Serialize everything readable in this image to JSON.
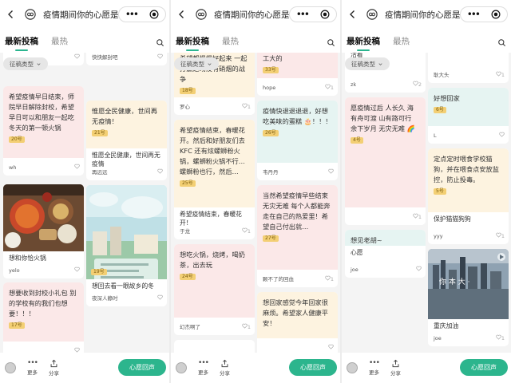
{
  "header": {
    "title": "疫情期间你的心愿是...",
    "tabs": [
      "最新投稿",
      "最热"
    ],
    "filter_label": "征稿类型"
  },
  "bottom": {
    "more": "更多",
    "share": "分享",
    "cta": "心愿回声"
  },
  "colors": {
    "accent": "#2cb58d",
    "pink": "#fbe8e8",
    "yellow": "#fdf3e0",
    "teal": "#e6f4f2",
    "badge": "#f3cf74"
  },
  "screens": [
    {
      "left": [
        {
          "kind": "tail",
          "user": "...",
          "likes": ""
        },
        {
          "kind": "text",
          "tint": "pink",
          "text": "希望疫情早日结束，师院早日解除封校，希望早日可以和朋友一起吃冬天的第一顿火锅",
          "badge": "20号",
          "user": "wh",
          "likes": ""
        },
        {
          "kind": "image",
          "scene": "food",
          "title": "想和你恰火锅",
          "user": "yelo",
          "likes": ""
        },
        {
          "kind": "text",
          "tint": "pink",
          "text": "想要收到封校小礼包 别的学校有的我们也想要！！！",
          "badge": "17号",
          "user": "",
          "likes": ""
        }
      ],
      "right": [
        {
          "kind": "tail",
          "user": "快快解封吧",
          "likes": ""
        },
        {
          "kind": "text",
          "tint": "yellow",
          "text": "惟愿全民健康，世间再无疫情！",
          "badge": "21号",
          "title": "惟愿全民健康，世间再无疫情",
          "user": "再远远",
          "likes": ""
        },
        {
          "kind": "image",
          "scene": "poster",
          "badge": "19号",
          "title": "想回去看一眼故乡的冬",
          "user": "夜深人静时",
          "likes": ""
        }
      ]
    },
    {
      "left": [
        {
          "kind": "text",
          "tint": "yellow",
          "text": "希望都慢慢好起来 一起打赢这场没有硝烟的战争",
          "badge": "18号",
          "user": "罗心",
          "likes": "1"
        },
        {
          "kind": "text",
          "tint": "yellow",
          "text": "希望疫情结束，春暖花开。然后和好朋友们去KFC 还有炫螺蛳粉火锅，螺蛳粉火锅不行…螺蛳粉也行，然后…",
          "badge": "25号",
          "title": "希望疫情结束，春暖花开！",
          "user": "于龙",
          "likes": "1"
        },
        {
          "kind": "text",
          "tint": "pink",
          "text": "想吃火锅，烧烤，喝奶茶，出去玩",
          "badge": "24号",
          "user": "幻杰啊了",
          "likes": "1"
        },
        {
          "kind": "tail",
          "user": "",
          "likes": ""
        }
      ],
      "right": [
        {
          "kind": "text",
          "tint": "pink",
          "text": "工大的",
          "badge": "33号",
          "user": "hope",
          "likes": "1"
        },
        {
          "kind": "text",
          "tint": "teal",
          "text": "疫情快退退退退，好想吃美味的蛋糕 🎂！！！",
          "badge": "26号",
          "user": "韦丹丹",
          "likes": ""
        },
        {
          "kind": "text",
          "tint": "pink",
          "text": "当然希望疫情早些结束 无灾无难 每个人都能奔走在自己的热爱里！希望自己付出就…",
          "badge": "27号",
          "user": "颗不了的回血",
          "likes": "1"
        },
        {
          "kind": "text",
          "tint": "yellow",
          "text": "想回家感觉今年回家很麻烦。希望家人健康平安！",
          "badge": "",
          "user": "",
          "likes": ""
        }
      ]
    },
    {
      "left": [
        {
          "kind": "tail",
          "title": "活着",
          "user": "zk",
          "likes": "2"
        },
        {
          "kind": "text",
          "tint": "pink",
          "text": "愿疫情过后 人长久 海有舟可渡 山有路可行 余下岁月 无灾无难 🌈",
          "badge": "4号",
          "user": "",
          "likes": "1"
        },
        {
          "kind": "text",
          "tint": "teal",
          "text": "想见老胡~",
          "badge": "3号",
          "title": "心愿",
          "user": "joe",
          "likes": ""
        }
      ],
      "right": [
        {
          "kind": "tail",
          "user": "耿大头",
          "likes": "1"
        },
        {
          "kind": "text",
          "tint": "teal",
          "text": "好想回家",
          "badge": "6号",
          "user": "L",
          "likes": ""
        },
        {
          "kind": "text",
          "tint": "yellow",
          "text": "定点定时喂食学校猫狗，并在喂食点安放监控，防止投毒。",
          "badge": "5号",
          "title": "保护猫猫狗狗",
          "user": "yyy",
          "likes": "1"
        },
        {
          "kind": "image",
          "scene": "city",
          "title": "重庆加油",
          "user": "joe",
          "likes": "1"
        }
      ]
    }
  ]
}
